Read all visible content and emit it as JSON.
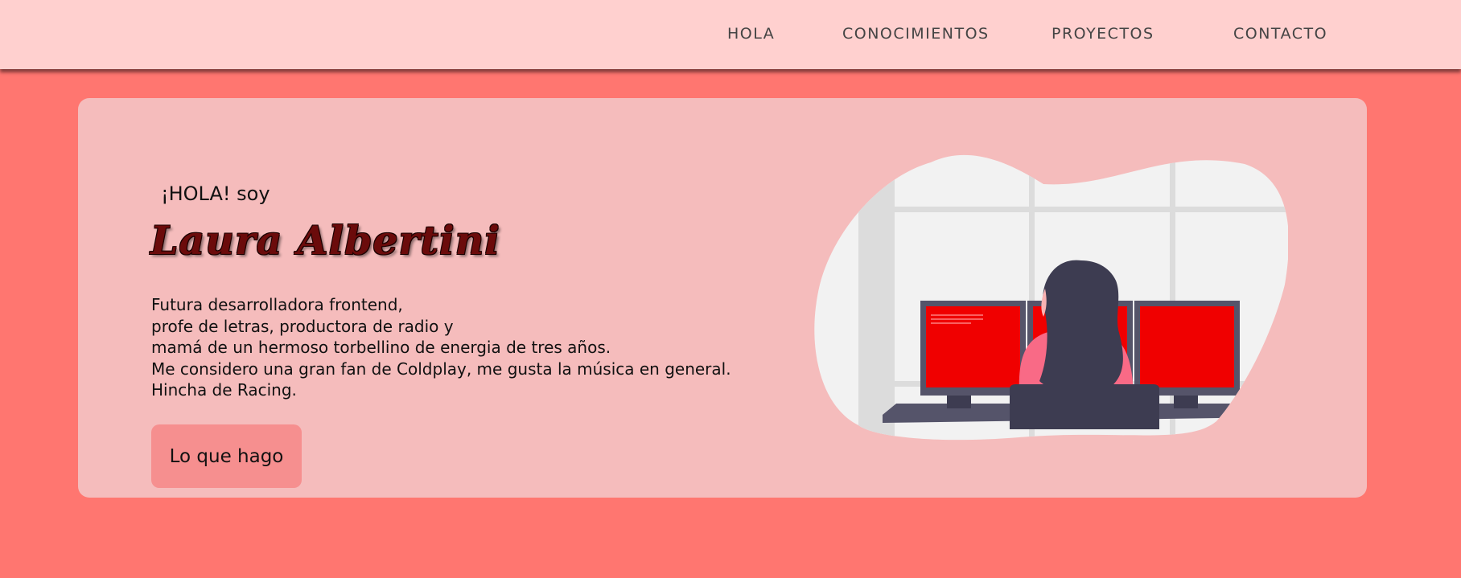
{
  "nav": {
    "links": [
      "HOLA",
      "CONOCIMIENTOS",
      "PROYECTOS",
      "CONTACTO"
    ]
  },
  "hero": {
    "greeting": "¡HOLA! soy",
    "name": "Laura Albertini",
    "bio_lines": [
      "Futura desarrolladora frontend,",
      "profe de letras, productora de radio y",
      "mamá de un hermoso torbellino de energia de tres años.",
      "Me considero una gran fan de Coldplay, me gusta la música en general.",
      "Hincha de Racing."
    ],
    "cta_label": "Lo que hago"
  },
  "colors": {
    "page_background": "#ff7670",
    "navbar_background": "#ffd0cf",
    "card_background": "#f5bcbc",
    "button_background": "#f68f8f",
    "name_color": "#6b0b0b",
    "monitor_screen": "#f00000"
  },
  "illustration": {
    "icon": "woman-at-computer-illustration"
  }
}
